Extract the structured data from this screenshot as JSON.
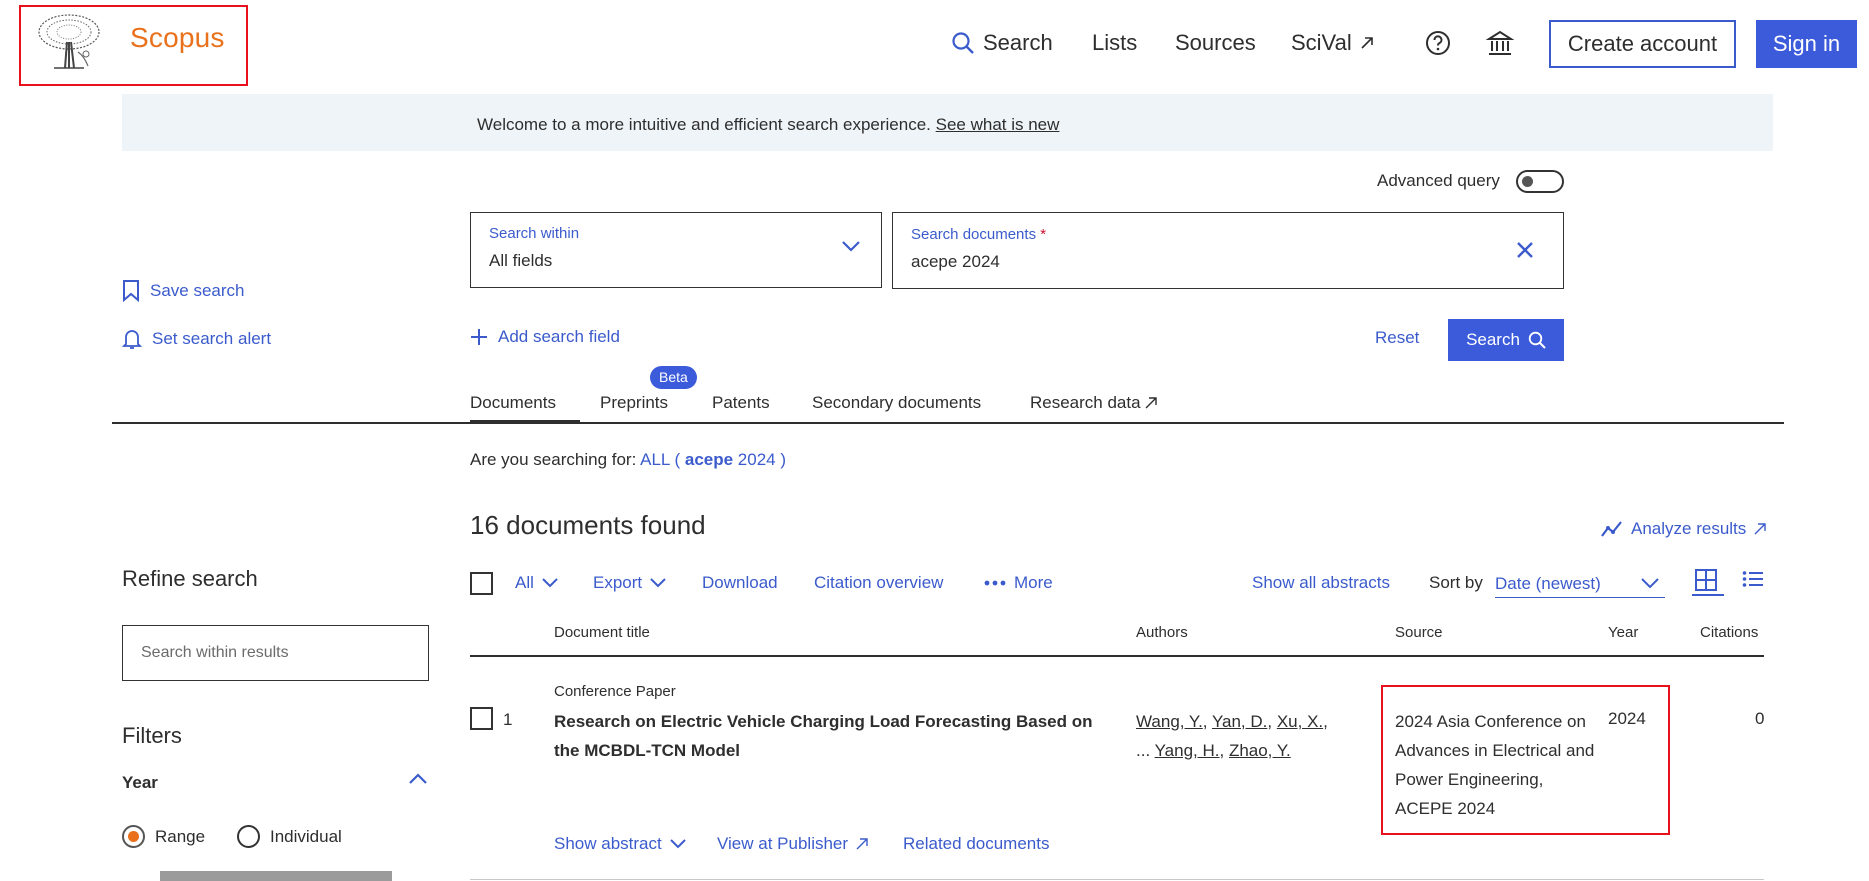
{
  "header": {
    "brand": "Scopus",
    "nav": [
      {
        "label": "Search",
        "icon": "search-icon"
      },
      {
        "label": "Lists"
      },
      {
        "label": "Sources"
      },
      {
        "label": "SciVal",
        "icon": "external-link-icon"
      }
    ],
    "icons": [
      "help-icon",
      "institution-icon"
    ],
    "create_account": "Create account",
    "sign_in": "Sign in"
  },
  "banner": {
    "text": "Welcome to a more intuitive and efficient search experience.",
    "link": "See what is new"
  },
  "search": {
    "advanced_query_label": "Advanced query",
    "advanced_query_on": false,
    "within_label": "Search within",
    "within_value": "All fields",
    "documents_label": "Search documents",
    "required_marker": "*",
    "documents_value": "acepe 2024",
    "add_field": "Add search field",
    "reset": "Reset",
    "search_button": "Search"
  },
  "side_actions": {
    "save_search": "Save search",
    "set_alert": "Set search alert"
  },
  "tabs": {
    "items": [
      "Documents",
      "Preprints",
      "Patents",
      "Secondary documents",
      "Research data"
    ],
    "active": "Documents",
    "beta_badge": "Beta"
  },
  "query": {
    "prefix": "Are you searching for:",
    "field": "ALL (",
    "term_bold": "acepe",
    "term_rest": "2024 )"
  },
  "results": {
    "count_text": "16 documents found",
    "analyze": "Analyze results"
  },
  "toolbar": {
    "all": "All",
    "export": "Export",
    "download": "Download",
    "citation_overview": "Citation overview",
    "more": "More",
    "show_all_abstracts": "Show all abstracts",
    "sort_by_label": "Sort by",
    "sort_value": "Date (newest)"
  },
  "table": {
    "headers": {
      "title": "Document title",
      "authors": "Authors",
      "source": "Source",
      "year": "Year",
      "citations": "Citations"
    },
    "rows": [
      {
        "number": "1",
        "doc_type": "Conference Paper",
        "title": "Research on Electric Vehicle Charging Load Forecasting Based on the MCBDL-TCN Model",
        "authors": [
          "Wang, Y.",
          "Yan, D.",
          "Xu, X.",
          "Yang, H.",
          "Zhao, Y."
        ],
        "author_ellipsis": "...",
        "source": "2024 Asia Conference on Advances in Electrical and Power Engineering, ACEPE 2024",
        "year": "2024",
        "citations": "0",
        "actions": {
          "show_abstract": "Show abstract",
          "view_publisher": "View at Publisher",
          "related": "Related documents"
        }
      }
    ]
  },
  "refine": {
    "title": "Refine search",
    "placeholder": "Search within results",
    "filters_title": "Filters",
    "year_label": "Year",
    "range_label": "Range",
    "individual_label": "Individual",
    "range_selected": true
  },
  "colors": {
    "brand_orange": "#e9711c",
    "primary_blue": "#3b5bdb",
    "highlight_red": "#e8101c",
    "banner_bg": "#eef4f8"
  }
}
